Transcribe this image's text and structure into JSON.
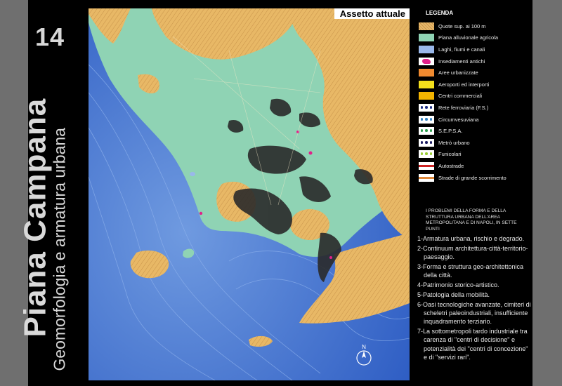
{
  "slide": {
    "number": "14",
    "title": "Piana Campana",
    "subtitle": "Geomorfologia e armatura urbana"
  },
  "map": {
    "title": "Assetto attuale",
    "north_symbol": "N"
  },
  "legend": {
    "title": "LEGENDA",
    "items": [
      {
        "label": "Quote sup. ai 100 m",
        "color": "#e6b86a",
        "icon": "hatched-tan"
      },
      {
        "label": "Piana alluvionale agricola",
        "color": "#8fd3b4",
        "icon": "solid"
      },
      {
        "label": "Laghi, fiumi e canali",
        "color": "#9ab8ea",
        "icon": "solid"
      },
      {
        "label": "Insediamenti antichi",
        "color": "#e0208a",
        "icon": "blob"
      },
      {
        "label": "Aree urbanizzate",
        "color": "#f08a30",
        "icon": "solid"
      },
      {
        "label": "Aeroporti ed interporti",
        "color": "#f4e01c",
        "icon": "solid"
      },
      {
        "label": "Centri commerciali",
        "color": "#f4b400",
        "icon": "solid"
      },
      {
        "label": "Rete ferroviaria (F.S.)",
        "color": "#1a2a80",
        "icon": "dots"
      },
      {
        "label": "Circumvesuviana",
        "color": "#2f7fbf",
        "icon": "dots"
      },
      {
        "label": "S.E.P.S.A.",
        "color": "#2f9f4f",
        "icon": "dots"
      },
      {
        "label": "Metrò urbano",
        "color": "#1a1a60",
        "icon": "dots"
      },
      {
        "label": "Funicolari",
        "color": "#9acd32",
        "icon": "dots"
      },
      {
        "label": "Autostrade",
        "color": "#cc2222",
        "icon": "line"
      },
      {
        "label": "Strade di grande scorrimento",
        "color": "#e0883a",
        "icon": "line"
      }
    ]
  },
  "problems": {
    "heading": "I PROBLEMI DELLA FORMA E DELLA STRUTTURA URBANA DELL'AREA METROPOLITANA E DI NAPOLI, IN SETTE PUNTI",
    "points": [
      "1-Armatura urbana, rischio e degrado.",
      "2-Continuum architettura-città-territorio-paesaggio.",
      "3-Forma e struttura geo-architettonica della città.",
      "4-Patrimonio storico-artistico.",
      "5-Patologia della mobilità.",
      "6-Oasi tecnologiche avanzate, cimiteri di scheletri paleoindustriali, insufficiente inquadramento terziario.",
      "7-La sottometropoli tardo industriale tra carenza di \"centri di decisione\" e potenzialità dei \"centri di concezione\" e di \"servizi rari\"."
    ]
  }
}
